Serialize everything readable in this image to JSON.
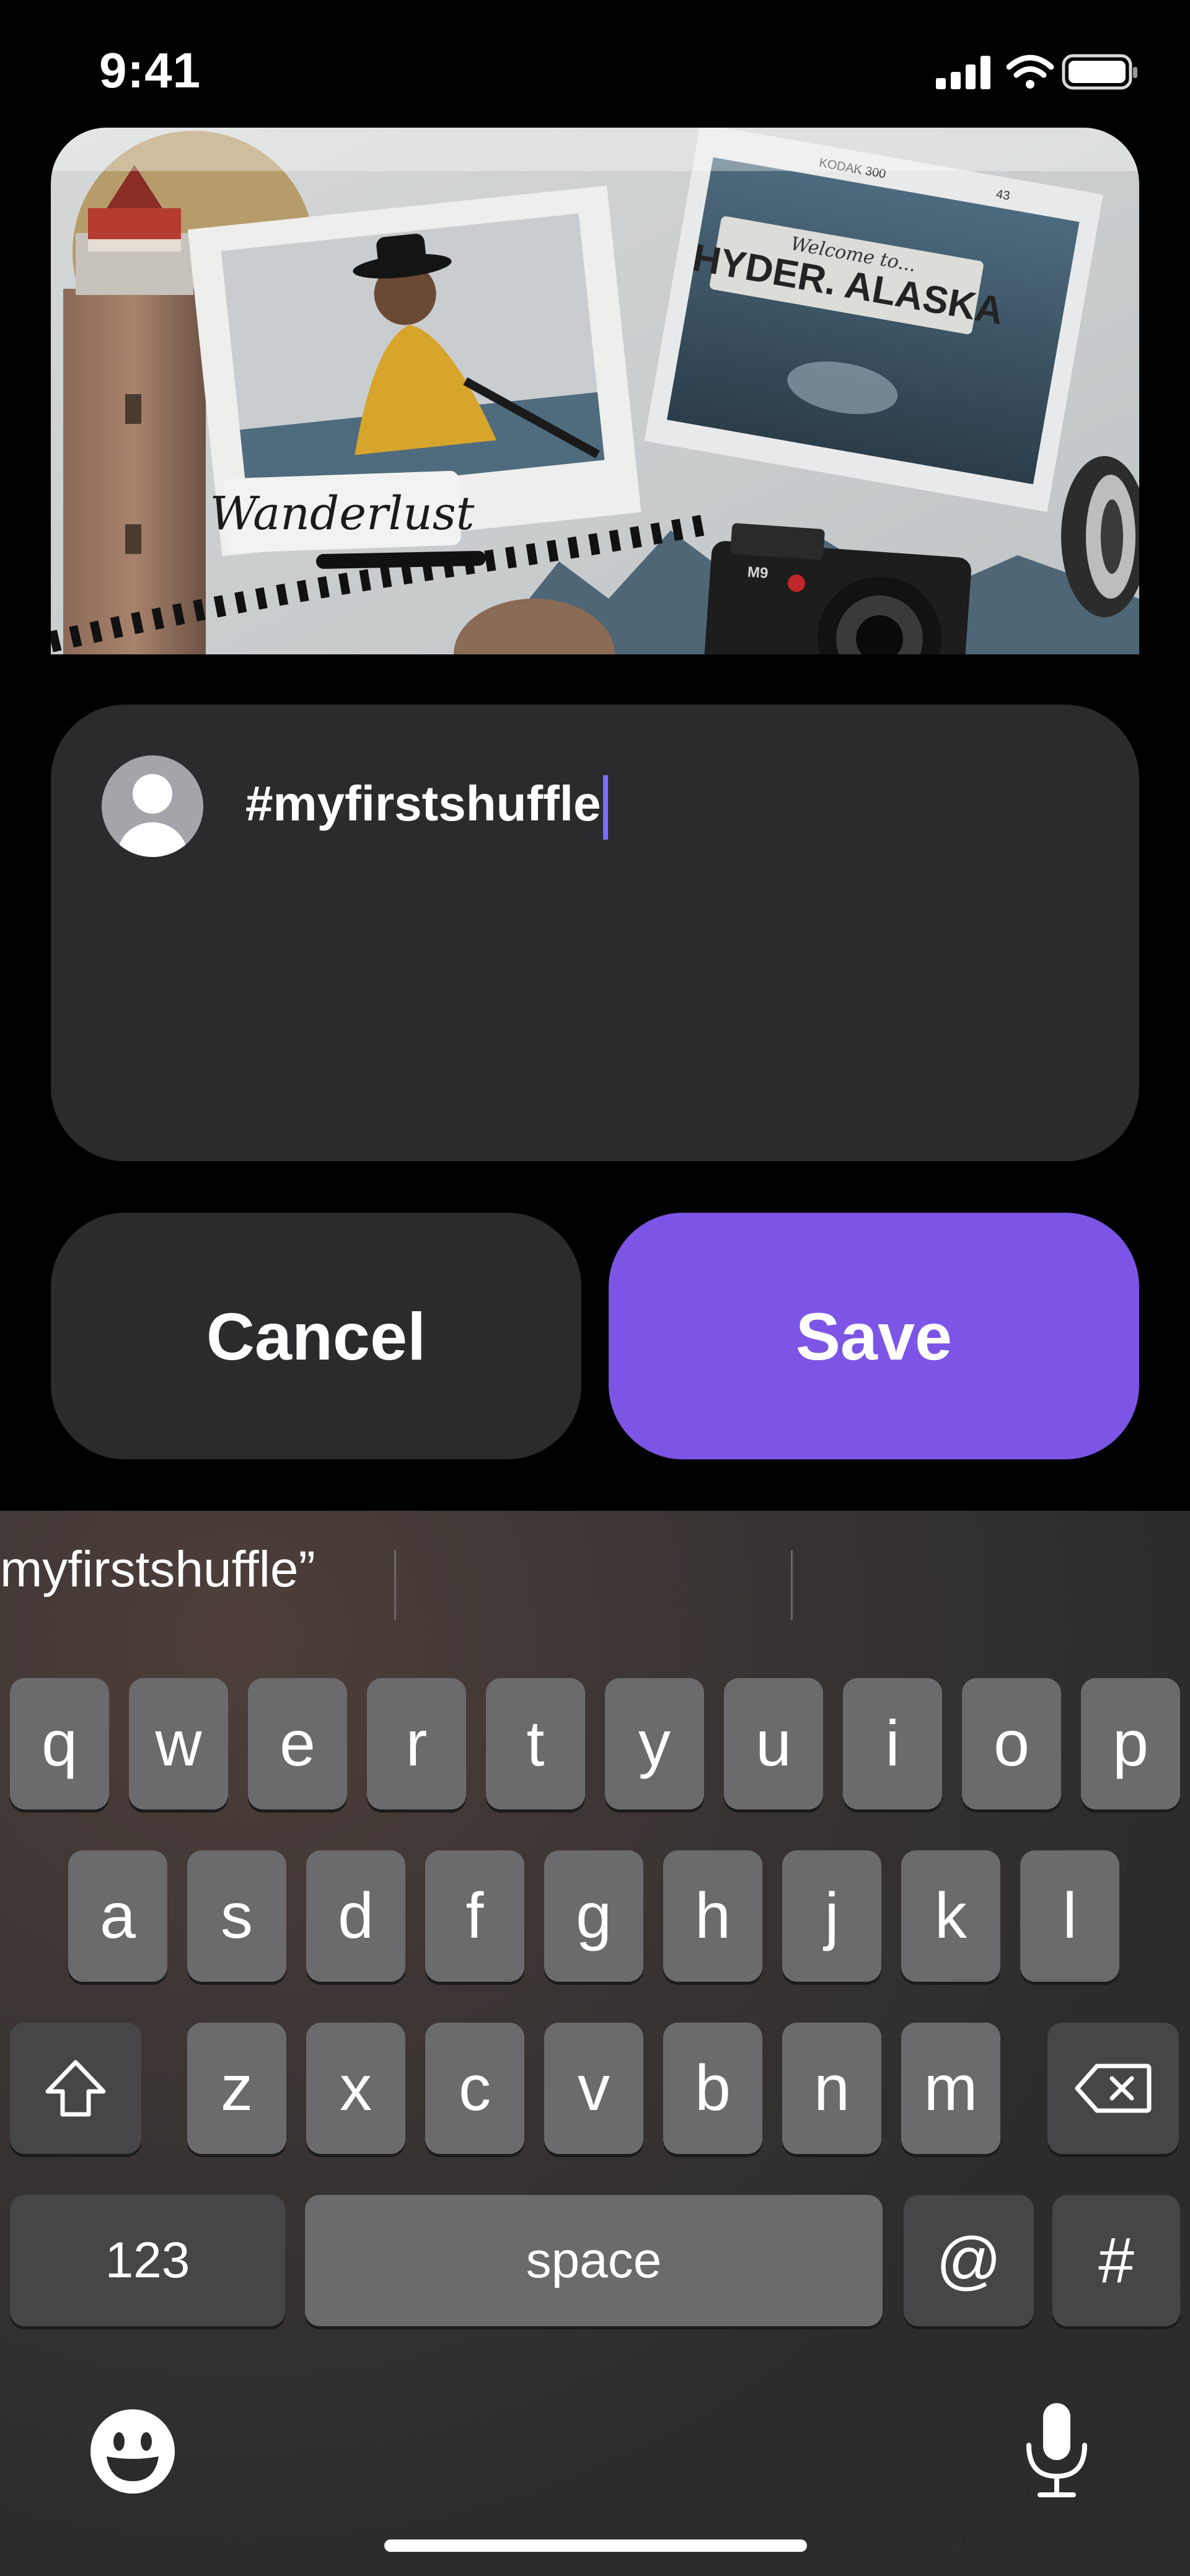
{
  "status_bar": {
    "time": "9:41",
    "icons": [
      "cellular-signal-icon",
      "wifi-icon",
      "battery-icon"
    ]
  },
  "collage": {
    "sign_text_script": "Welcome to...",
    "sign_text": "HYDER. ALASKA",
    "label_text": "Wanderlust",
    "film_text": "KODAK 300",
    "film_frame": "43",
    "camera_model": "M9"
  },
  "composer": {
    "avatar_icon": "user-avatar-icon",
    "caption_value": "#myfirstshuffle"
  },
  "actions": {
    "cancel_label": "Cancel",
    "save_label": "Save"
  },
  "keyboard": {
    "suggestion": "myfirstshuffle”",
    "row1": [
      "q",
      "w",
      "e",
      "r",
      "t",
      "y",
      "u",
      "i",
      "o",
      "p"
    ],
    "row2": [
      "a",
      "s",
      "d",
      "f",
      "g",
      "h",
      "j",
      "k",
      "l"
    ],
    "row3": [
      "z",
      "x",
      "c",
      "v",
      "b",
      "n",
      "m"
    ],
    "numbers_label": "123",
    "space_label": "space",
    "at_label": "@",
    "hash_label": "#",
    "icons": [
      "shift-icon",
      "delete-icon",
      "emoji-icon",
      "microphone-icon"
    ]
  },
  "colors": {
    "accent": "#7d55e6",
    "card": "#2b2b2d",
    "cursor": "#7b6cff"
  }
}
